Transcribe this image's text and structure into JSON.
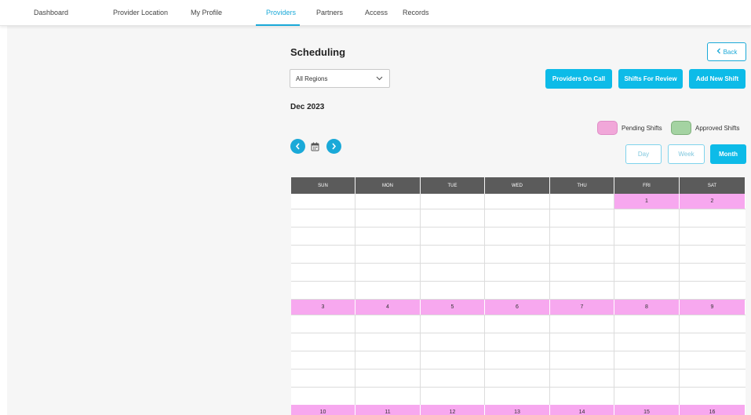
{
  "nav": {
    "items": [
      {
        "label": "Dashboard",
        "active": false
      },
      {
        "label": "Provider Location",
        "active": false
      },
      {
        "label": "My Profile",
        "active": false
      },
      {
        "label": "Providers",
        "active": true
      },
      {
        "label": "Partners",
        "active": false
      },
      {
        "label": "Access",
        "active": false
      },
      {
        "label": "Records",
        "active": false
      }
    ]
  },
  "page": {
    "title": "Scheduling",
    "back_label": "Back"
  },
  "filters": {
    "region_value": "All Regions"
  },
  "actions": {
    "providers_on_call": "Providers On Call",
    "shifts_for_review": "Shifts For Review",
    "add_new_shift": "Add New Shift"
  },
  "calendar": {
    "month_label": "Dec 2023",
    "legend": {
      "pending": {
        "label": "Pending Shifts",
        "color": "#f1a7d9"
      },
      "approved": {
        "label": "Approved Shifts",
        "color": "#a4d3a2"
      }
    },
    "views": {
      "day": "Day",
      "week": "Week",
      "month": "Month",
      "selected": "Month"
    },
    "weekdays": [
      "SUN",
      "MON",
      "TUE",
      "WED",
      "THU",
      "FRI",
      "SAT"
    ],
    "weeks": [
      [
        "",
        "",
        "",
        "",
        "",
        "1",
        "2"
      ],
      [
        "3",
        "4",
        "5",
        "6",
        "7",
        "8",
        "9"
      ],
      [
        "10",
        "11",
        "12",
        "13",
        "14",
        "15",
        "16"
      ]
    ]
  },
  "colors": {
    "accent": "#0dbbe8",
    "header_bg": "#5b5b5b",
    "date_bg": "#f7a8ef"
  },
  "icons": {
    "back": "chevron-left-icon",
    "select": "chevron-down-icon",
    "prev": "chevron-left-icon",
    "next": "chevron-right-icon",
    "calendar": "calendar-icon"
  }
}
